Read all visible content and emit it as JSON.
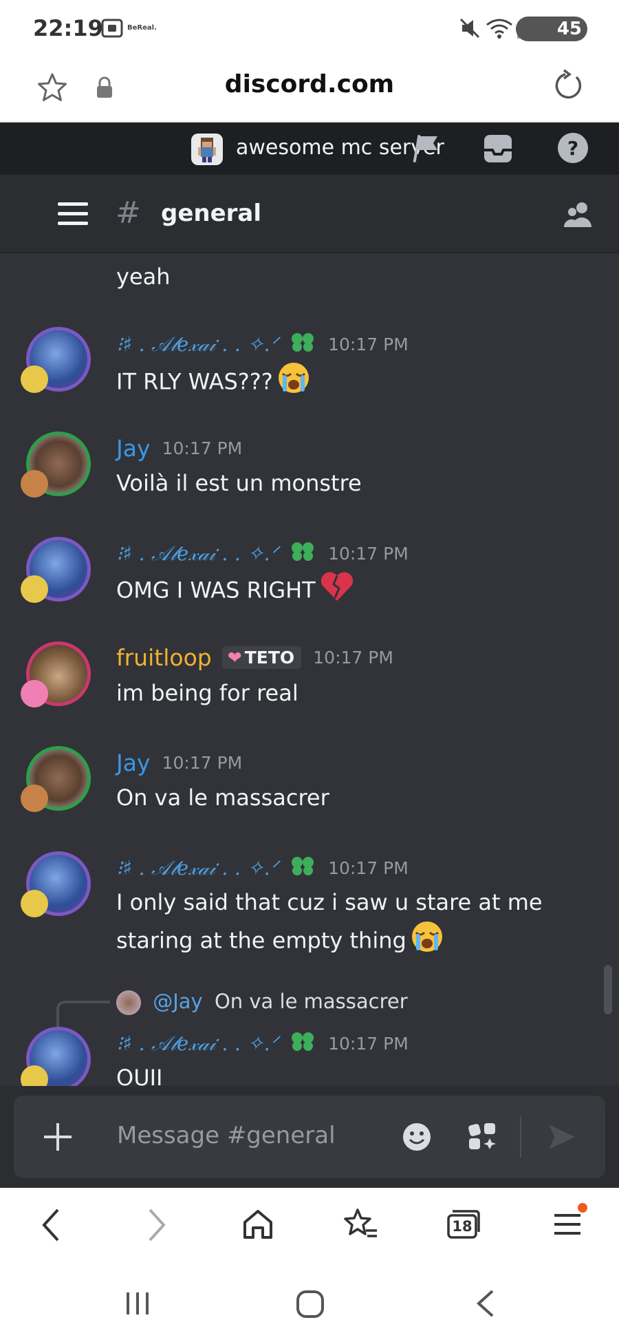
{
  "status_bar": {
    "time": "22:19",
    "app_badge": "BeReal.",
    "battery": "45"
  },
  "browser": {
    "domain": "discord.com",
    "tab_count": "18"
  },
  "server": {
    "name": "awesome mc server"
  },
  "channel": {
    "name": "general"
  },
  "messages": [
    {
      "content": "yeah"
    },
    {
      "author": "⁝♯ . 𝒜𝓁𝑒𝓍𝒶𝒾 . . ✧.ᐟ",
      "time": "10:17 PM",
      "content": "IT RLY WAS???"
    },
    {
      "author": "Jay",
      "time": "10:17 PM",
      "content": "Voilà il est un monstre"
    },
    {
      "author": "⁝♯ . 𝒜𝓁𝑒𝓍𝒶𝒾 . . ✧.ᐟ",
      "time": "10:17 PM",
      "content": "OMG I WAS RIGHT"
    },
    {
      "author": "fruitloop",
      "tag": "TETO",
      "time": "10:17 PM",
      "content": "im being for real"
    },
    {
      "author": "Jay",
      "time": "10:17 PM",
      "content": "On va le massacrer"
    },
    {
      "author": "⁝♯ . 𝒜𝓁𝑒𝓍𝒶𝒾 . . ✧.ᐟ",
      "time": "10:17 PM",
      "content": "I only said that cuz i saw u stare at me staring at the empty thing"
    },
    {
      "reply_mention": "@Jay",
      "reply_text": "On va le massacrer",
      "author": "⁝♯ . 𝒜𝓁𝑒𝓍𝒶𝒾 . . ✧.ᐟ",
      "time": "10:17 PM",
      "content": "OUII"
    }
  ],
  "composer": {
    "placeholder": "Message #general"
  },
  "colors": {
    "chat_bg": "#313338",
    "header_bg": "#1e1f22",
    "channel_bg": "#2b2d31",
    "alexai": "#4c9ee3",
    "jay": "#3b97e8",
    "fruitloop": "#f0b232"
  },
  "icons": [
    "star-icon",
    "lock-icon",
    "reload-icon",
    "flag-icon",
    "inbox-icon",
    "help-icon",
    "hamburger-icon",
    "members-icon",
    "plus-icon",
    "emoji-icon",
    "apps-icon",
    "send-icon",
    "back-icon",
    "forward-icon",
    "home-icon",
    "bookmarks-icon",
    "tabs-icon",
    "menu-icon"
  ]
}
